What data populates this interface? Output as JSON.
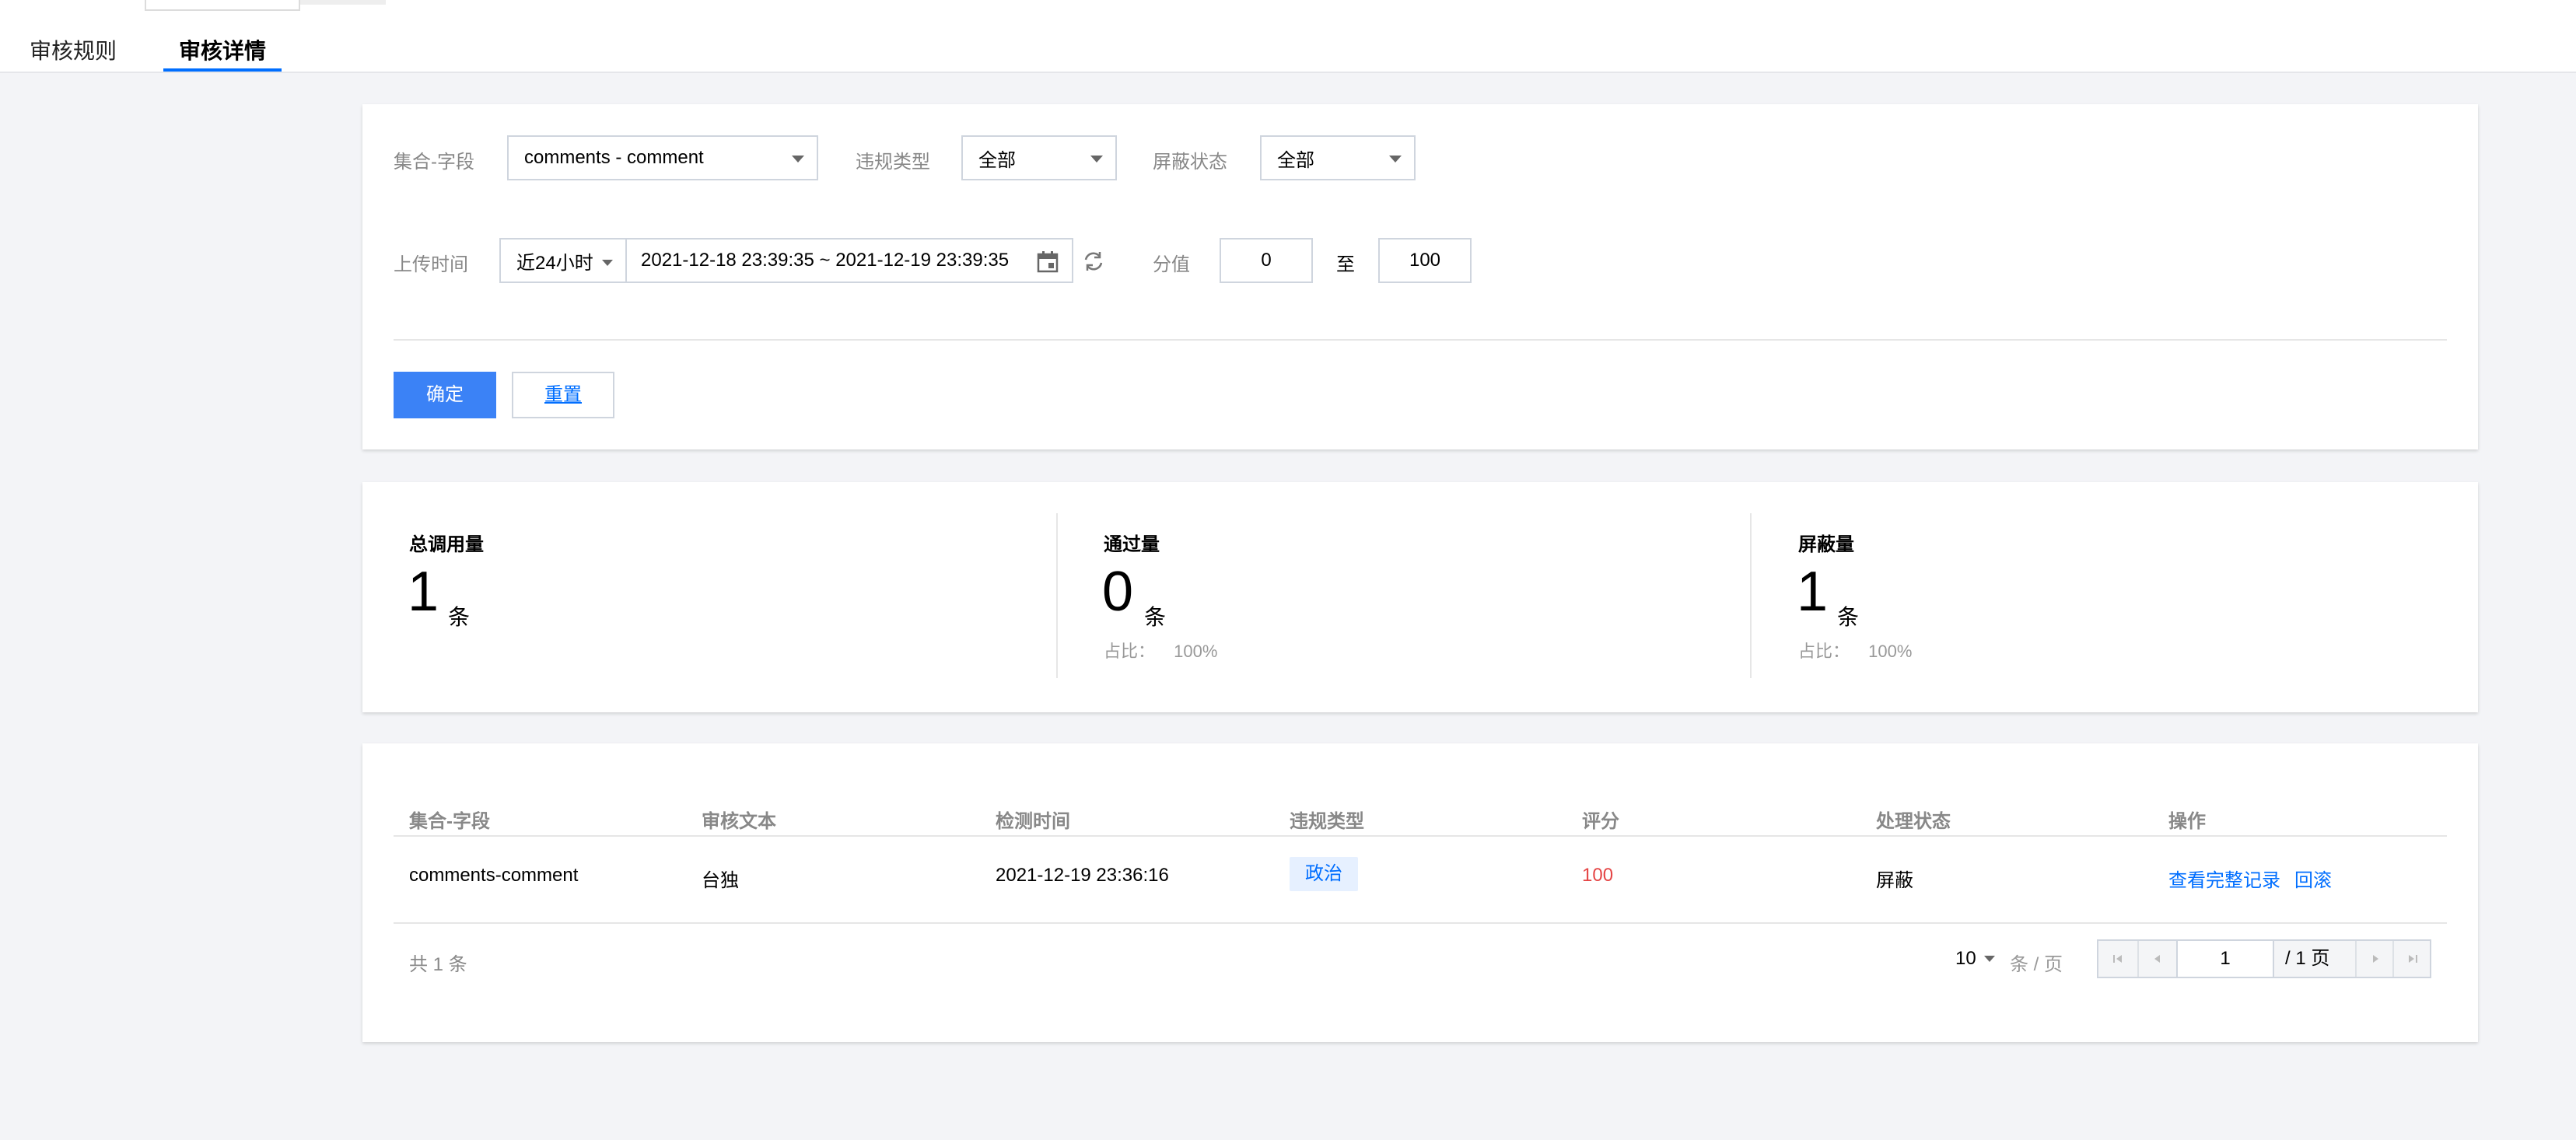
{
  "tabs": [
    {
      "label": "审核规则",
      "active": false
    },
    {
      "label": "审核详情",
      "active": true
    }
  ],
  "filters": {
    "collection_field": {
      "label": "集合-字段",
      "value": "comments - comment"
    },
    "violation_type": {
      "label": "违规类型",
      "value": "全部"
    },
    "block_status": {
      "label": "屏蔽状态",
      "value": "全部"
    },
    "upload_time": {
      "label": "上传时间",
      "preset": "近24小时",
      "range": "2021-12-18 23:39:35 ~ 2021-12-19 23:39:35"
    },
    "score": {
      "label": "分值",
      "min": "0",
      "to": "至",
      "max": "100"
    },
    "confirm_label": "确定",
    "reset_label": "重置"
  },
  "stats": [
    {
      "title": "总调用量",
      "value": "1",
      "unit": "条",
      "ratio_label": "",
      "ratio": ""
    },
    {
      "title": "通过量",
      "value": "0",
      "unit": "条",
      "ratio_label": "占比：",
      "ratio": "100%"
    },
    {
      "title": "屏蔽量",
      "value": "1",
      "unit": "条",
      "ratio_label": "占比：",
      "ratio": "100%"
    }
  ],
  "table": {
    "headers": [
      "集合-字段",
      "审核文本",
      "检测时间",
      "违规类型",
      "评分",
      "处理状态",
      "操作"
    ],
    "rows": [
      {
        "field": "comments-comment",
        "text": "台独",
        "time": "2021-12-19 23:36:16",
        "type": "政治",
        "score": "100",
        "status": "屏蔽",
        "actions": [
          "查看完整记录",
          "回滚"
        ]
      }
    ],
    "total": "共 1 条",
    "page_size": "10",
    "page_size_unit": "条 / 页",
    "current_page": "1",
    "total_pages": "/ 1 页"
  },
  "colors": {
    "accent": "#006eff",
    "primary_button": "#3b82f6",
    "score_red": "#e54545"
  }
}
